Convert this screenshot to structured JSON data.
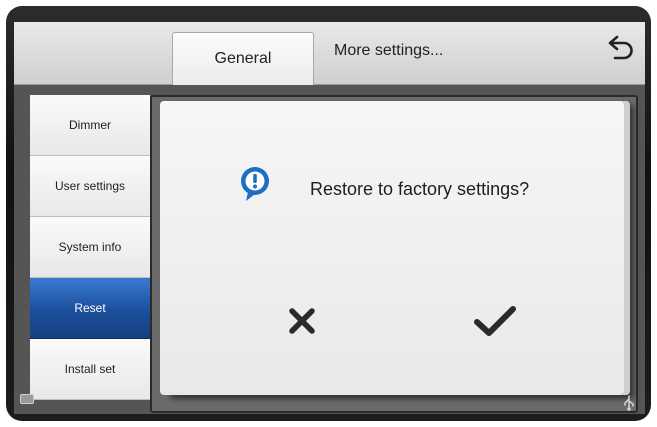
{
  "tabs": {
    "general": "General",
    "more_settings": "More settings..."
  },
  "sidebar": {
    "items": [
      {
        "label": "Dimmer"
      },
      {
        "label": "User settings"
      },
      {
        "label": "System info"
      },
      {
        "label": "Reset",
        "active": true
      },
      {
        "label": "Install set"
      }
    ]
  },
  "dialog": {
    "message": "Restore to factory settings?",
    "icon": "info-bubble-icon",
    "cancel_icon": "close-icon",
    "confirm_icon": "check-icon"
  },
  "colors": {
    "active_item": "#1c4f9c",
    "info_icon": "#1d6fc2"
  }
}
